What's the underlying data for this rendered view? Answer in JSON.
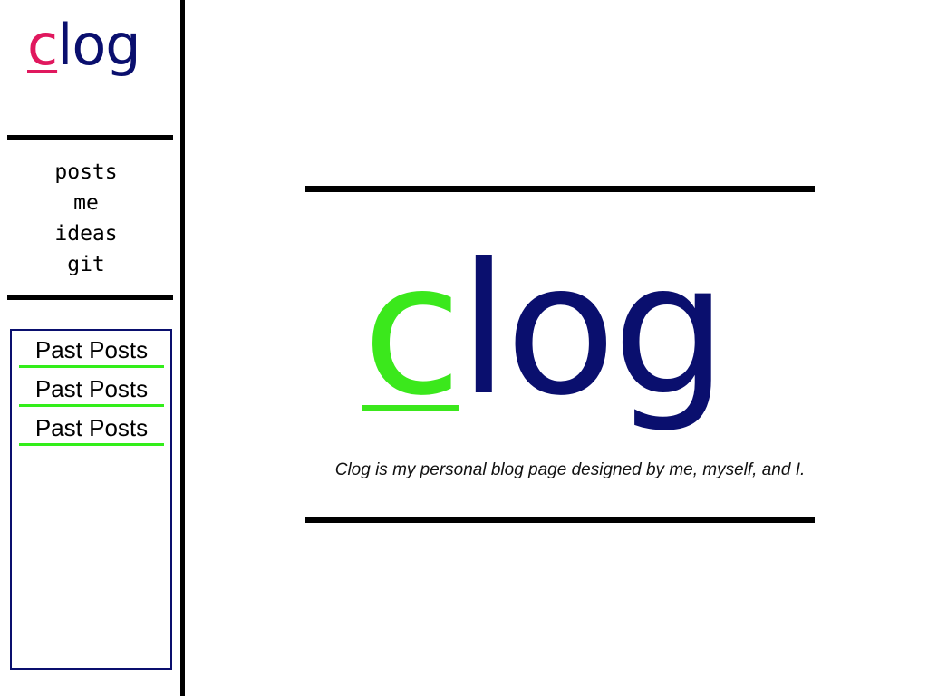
{
  "sidebar": {
    "logo": {
      "first_letter": "c",
      "rest": "log",
      "first_color": "#e0185e",
      "rest_color": "#0a0f6e"
    },
    "nav": [
      {
        "label": "posts"
      },
      {
        "label": "me"
      },
      {
        "label": "ideas"
      },
      {
        "label": "git"
      }
    ],
    "past_posts": [
      {
        "label": "Past Posts"
      },
      {
        "label": "Past Posts"
      },
      {
        "label": "Past Posts"
      }
    ]
  },
  "main": {
    "hero_logo": {
      "first_letter": "c",
      "rest": "log",
      "first_color": "#3be81c",
      "rest_color": "#0a0f6e"
    },
    "tagline": "Clog is my personal blog page designed by me, myself, and I."
  },
  "colors": {
    "accent_green": "#33ee1a",
    "accent_pink": "#e0185e",
    "navy": "#0a0f6e",
    "rule": "#000000"
  }
}
